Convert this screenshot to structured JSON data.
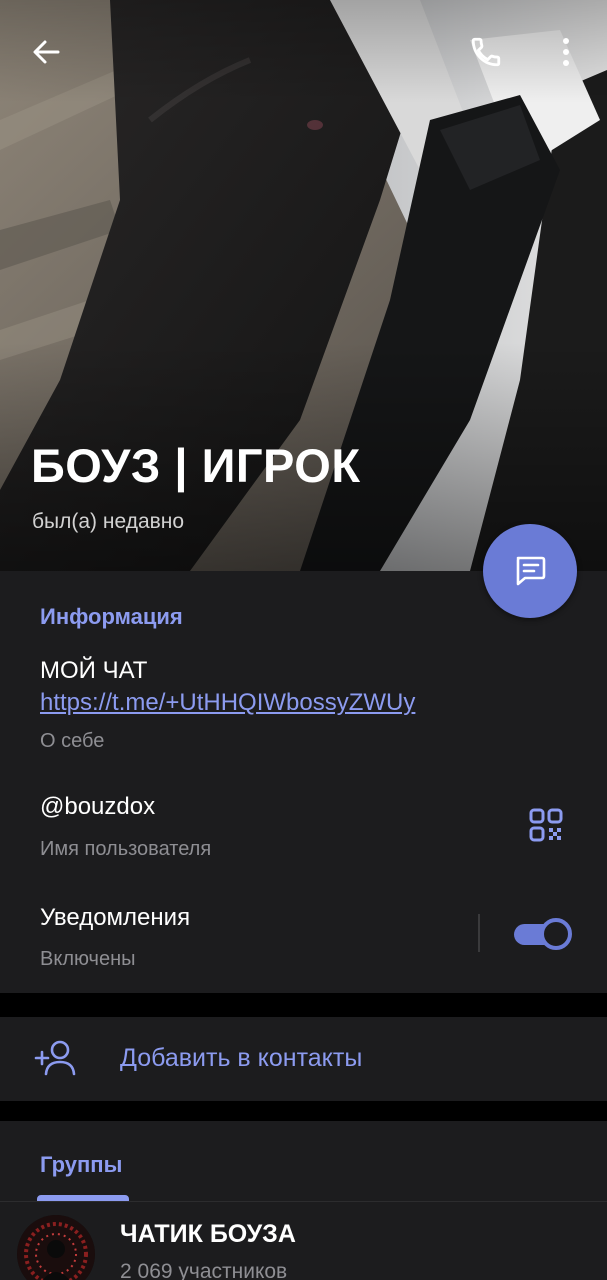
{
  "header": {
    "name": "БОУЗ | ИГРОК",
    "status": "был(а) недавно",
    "back_icon": "back-arrow-icon",
    "call_icon": "phone-icon",
    "more_icon": "more-vertical-icon",
    "message_icon": "message-icon"
  },
  "info": {
    "title": "Информация",
    "bio_text": "МОЙ ЧАТ",
    "bio_link": "https://t.me/+UtHHQIWbossyZWUy",
    "bio_caption": "О себе",
    "username": "@bouzdox",
    "username_caption": "Имя пользователя",
    "notifications_label": "Уведомления",
    "notifications_caption": "Включены",
    "notifications_enabled": true
  },
  "add_contact": {
    "label": "Добавить в контакты"
  },
  "groups": {
    "tab_label": "Группы",
    "items": [
      {
        "name": "ЧАТИК БОУЗА",
        "members": "2 069 участников"
      }
    ]
  },
  "colors": {
    "accent": "#8c9bf0",
    "fab": "#6a7bd6",
    "card": "#1c1c1e",
    "background": "#000000",
    "secondary_text": "#8e8e93"
  }
}
